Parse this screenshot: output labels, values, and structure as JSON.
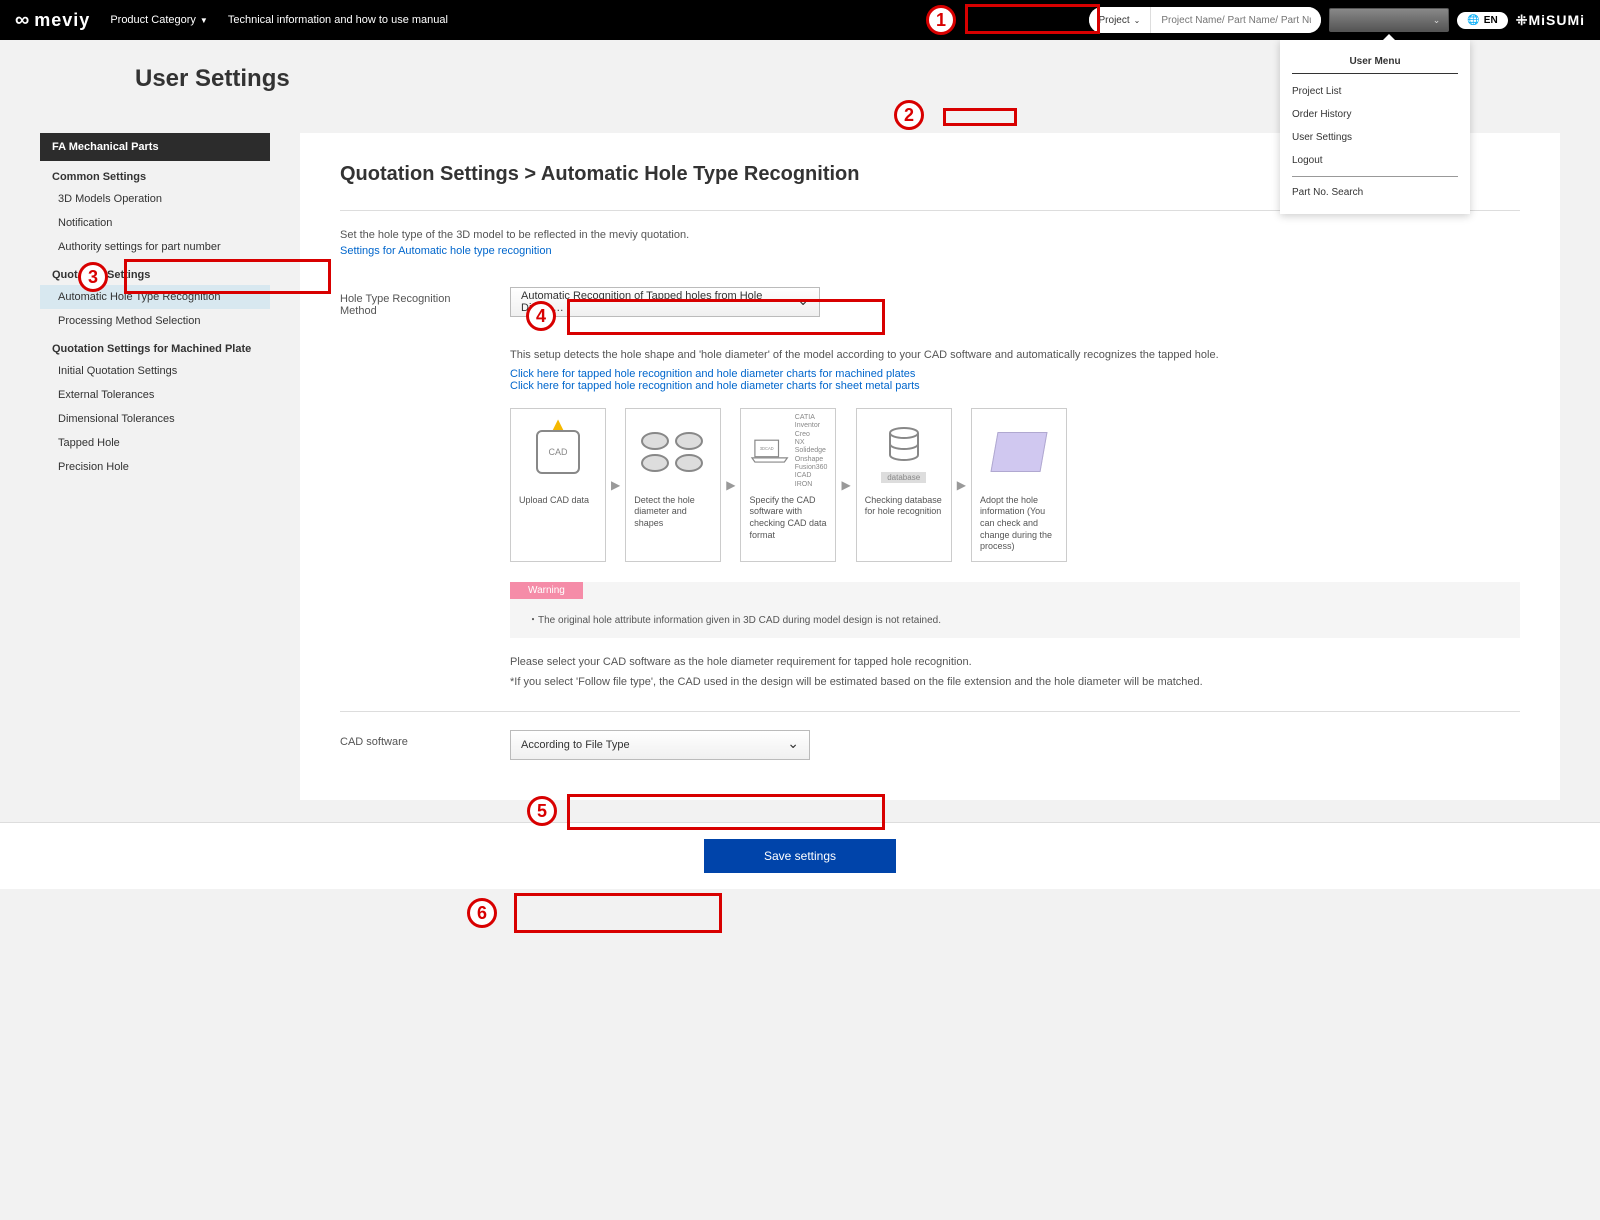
{
  "topbar": {
    "logo": "meviy",
    "nav1": "Product Category",
    "nav2": "Technical information and how to use manual",
    "search_prefix": "Project",
    "search_placeholder": "Project Name/ Part Name/ Part Number",
    "lang": "EN",
    "brand": "MiSUMi"
  },
  "user_menu": {
    "title": "User Menu",
    "items": [
      "Project List",
      "Order History",
      "User Settings",
      "Logout",
      "Part No. Search"
    ]
  },
  "page_title": "User Settings",
  "sidebar": {
    "header": "FA Mechanical Parts",
    "section1": "Common Settings",
    "items1": [
      "3D Models Operation",
      "Notification",
      "Authority settings for part number"
    ],
    "section2": "Quotation Settings",
    "items2": [
      "Automatic Hole Type Recognition",
      "Processing Method Selection"
    ],
    "section3": "Quotation Settings for Machined Plate",
    "items3": [
      "Initial Quotation Settings",
      "External Tolerances",
      "Dimensional Tolerances",
      "Tapped Hole",
      "Precision Hole"
    ]
  },
  "main": {
    "title": "Quotation Settings > Automatic Hole Type Recognition",
    "desc": "Set the hole type of the 3D model to be reflected in the meviy quotation.",
    "desc_link": "Settings for Automatic hole type recognition",
    "row1_label": "Hole Type Recognition Method",
    "row1_value": "Automatic Recognition of Tapped holes from Hole Diame…",
    "info1": "This setup detects the hole shape and 'hole diameter' of the model according to your CAD software and automatically recognizes the tapped hole.",
    "link1": "Click here for tapped hole recognition and hole diameter charts for machined plates",
    "link2": "Click here for tapped hole recognition and hole diameter charts for sheet metal parts",
    "process": [
      "Upload CAD data",
      "Detect the hole diameter and shapes",
      "Specify the CAD software with checking CAD data format",
      "Checking database for hole recognition",
      "Adopt the hole information (You can check and change during the process)"
    ],
    "cad_label": "CAD",
    "cad_3d_label": "3DCAD",
    "db_label": "database",
    "cad_list": [
      "CATIA",
      "Inventor",
      "Creo",
      "NX",
      "Solidedge",
      "Onshape",
      "Fusion360",
      "ICAD",
      "IRON"
    ],
    "warning_label": "Warning",
    "warning_text": "・The original hole attribute information given in 3D CAD during model design is not retained.",
    "info2a": "Please select your CAD software as the hole diameter requirement for tapped hole recognition.",
    "info2b": "*If you select 'Follow file type', the CAD used in the design will be estimated based on the file extension and the hole diameter will be matched.",
    "row2_label": "CAD software",
    "row2_value": "According to File Type",
    "save_btn": "Save settings"
  },
  "tags": [
    "1",
    "2",
    "3",
    "4",
    "5",
    "6"
  ]
}
